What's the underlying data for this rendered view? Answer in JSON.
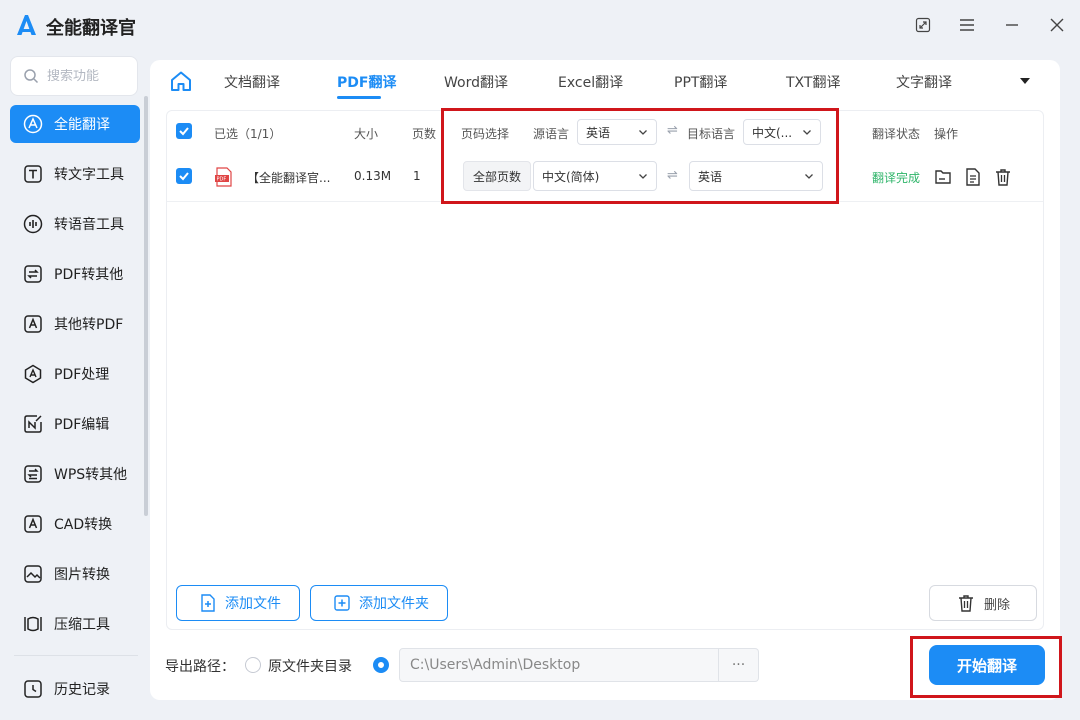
{
  "app": {
    "title": "全能翻译官"
  },
  "search": {
    "placeholder": "搜索功能"
  },
  "sidebar": {
    "items": [
      {
        "label": "全能翻译",
        "icon": "translate-icon",
        "active": true
      },
      {
        "label": "转文字工具",
        "icon": "text-t-icon"
      },
      {
        "label": "转语音工具",
        "icon": "audio-wave-icon"
      },
      {
        "label": "PDF转其他",
        "icon": "convert-arrows-icon"
      },
      {
        "label": "其他转PDF",
        "icon": "pdf-file-icon"
      },
      {
        "label": "PDF处理",
        "icon": "pdf-process-icon"
      },
      {
        "label": "PDF编辑",
        "icon": "edit-icon"
      },
      {
        "label": "WPS转其他",
        "icon": "wps-convert-icon"
      },
      {
        "label": "CAD转换",
        "icon": "cad-icon"
      },
      {
        "label": "图片转换",
        "icon": "image-icon"
      },
      {
        "label": "压缩工具",
        "icon": "compress-icon"
      }
    ],
    "history": "历史记录"
  },
  "tabs": [
    "文档翻译",
    "PDF翻译",
    "Word翻译",
    "Excel翻译",
    "PPT翻译",
    "TXT翻译",
    "文字翻译"
  ],
  "active_tab": "PDF翻译",
  "table": {
    "headers": {
      "selected": "已选（1/1）",
      "size": "大小",
      "pages": "页数",
      "page_select": "页码选择",
      "source_lang": "源语言",
      "target_lang": "目标语言",
      "status": "翻译状态",
      "actions": "操作"
    },
    "header_source_value": "英语",
    "header_target_value": "中文(...",
    "swap_symbol": "⇌",
    "row": {
      "file_name": "【全能翻译官...",
      "size": "0.13M",
      "pages": "1",
      "page_select": "全部页数",
      "source": "中文(简体)",
      "target": "英语",
      "status": "翻译完成"
    }
  },
  "buttons": {
    "add_file": "添加文件",
    "add_folder": "添加文件夹",
    "delete": "删除",
    "start": "开始翻译"
  },
  "export": {
    "label": "导出路径：",
    "option_original": "原文件夹目录",
    "path": "C:\\Users\\Admin\\Desktop",
    "browse": "···"
  },
  "colors": {
    "accent": "#1c8cf5",
    "success": "#2fb56a",
    "highlight_box": "#d0161b"
  }
}
